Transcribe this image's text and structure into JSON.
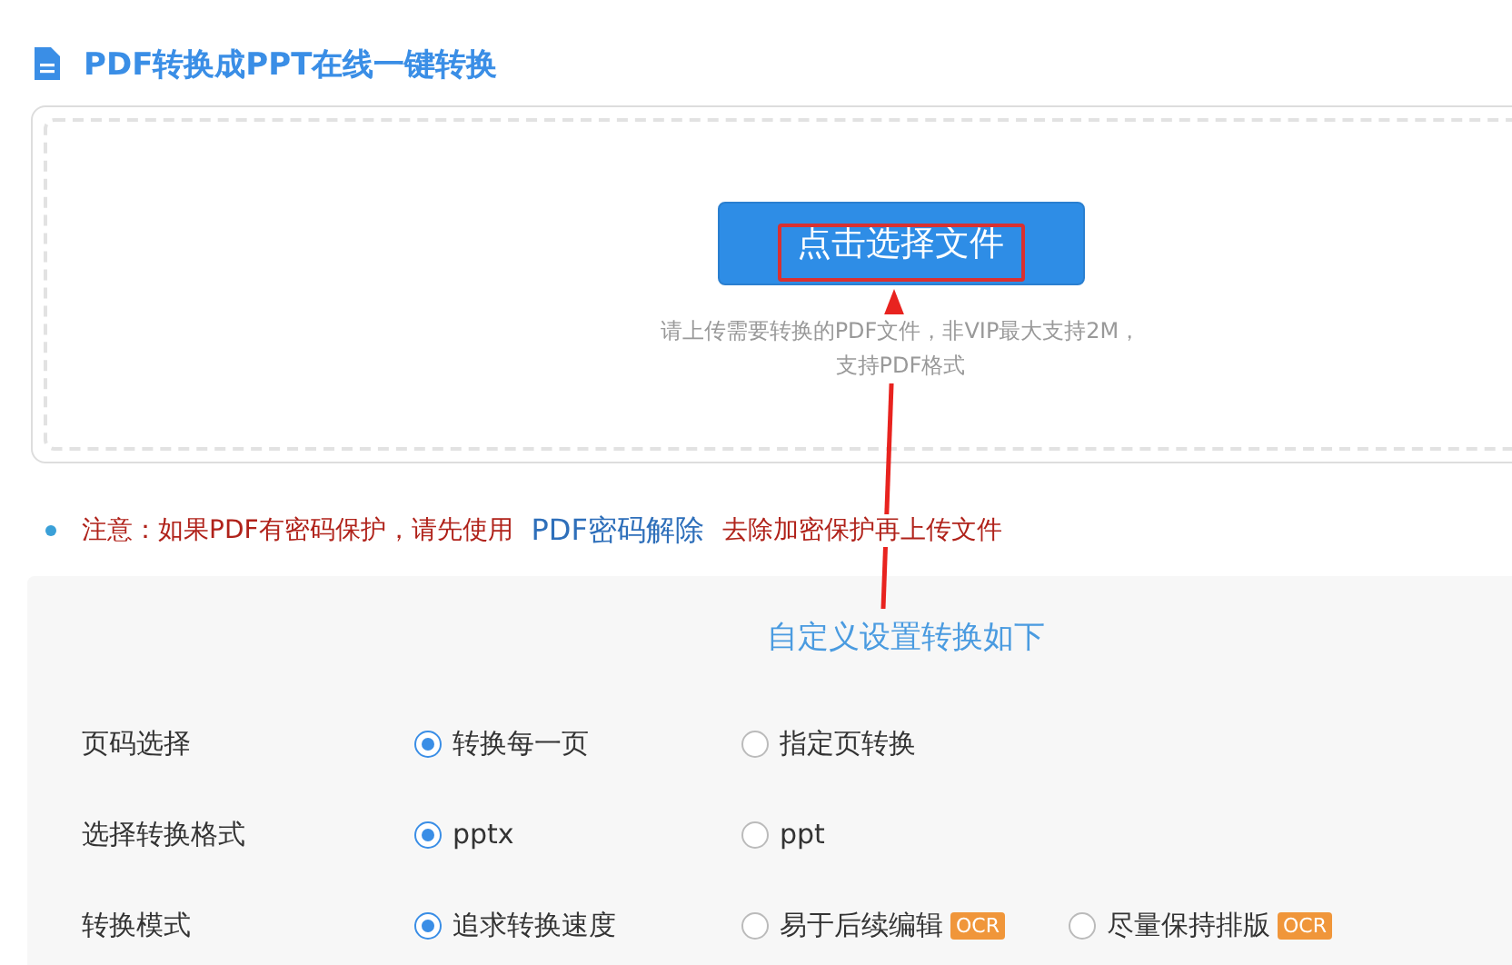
{
  "title": "PDF转换成PPT在线一键转换",
  "upload": {
    "button": "点击选择文件",
    "hint_lines": [
      "请上传需要转换的PDF文件，非VIP最大支持2M，",
      "支持PDF格式"
    ]
  },
  "notice": {
    "before": "注意：如果PDF有密码保护，请先使用",
    "link": "PDF密码解除",
    "after": "去除加密保护再上传文件"
  },
  "settings": {
    "heading": "自定义设置转换如下",
    "rows": [
      {
        "label": "页码选择",
        "options": [
          {
            "label": "转换每一页",
            "selected": true
          },
          {
            "label": "指定页转换",
            "selected": false
          }
        ]
      },
      {
        "label": "选择转换格式",
        "options": [
          {
            "label": "pptx",
            "selected": true
          },
          {
            "label": "ppt",
            "selected": false
          }
        ]
      },
      {
        "label": "转换模式",
        "options": [
          {
            "label": "追求转换速度",
            "selected": true
          },
          {
            "label": "易于后续编辑",
            "selected": false,
            "badge": "OCR"
          },
          {
            "label": "尽量保持排版",
            "selected": false,
            "badge": "OCR"
          }
        ]
      }
    ]
  }
}
